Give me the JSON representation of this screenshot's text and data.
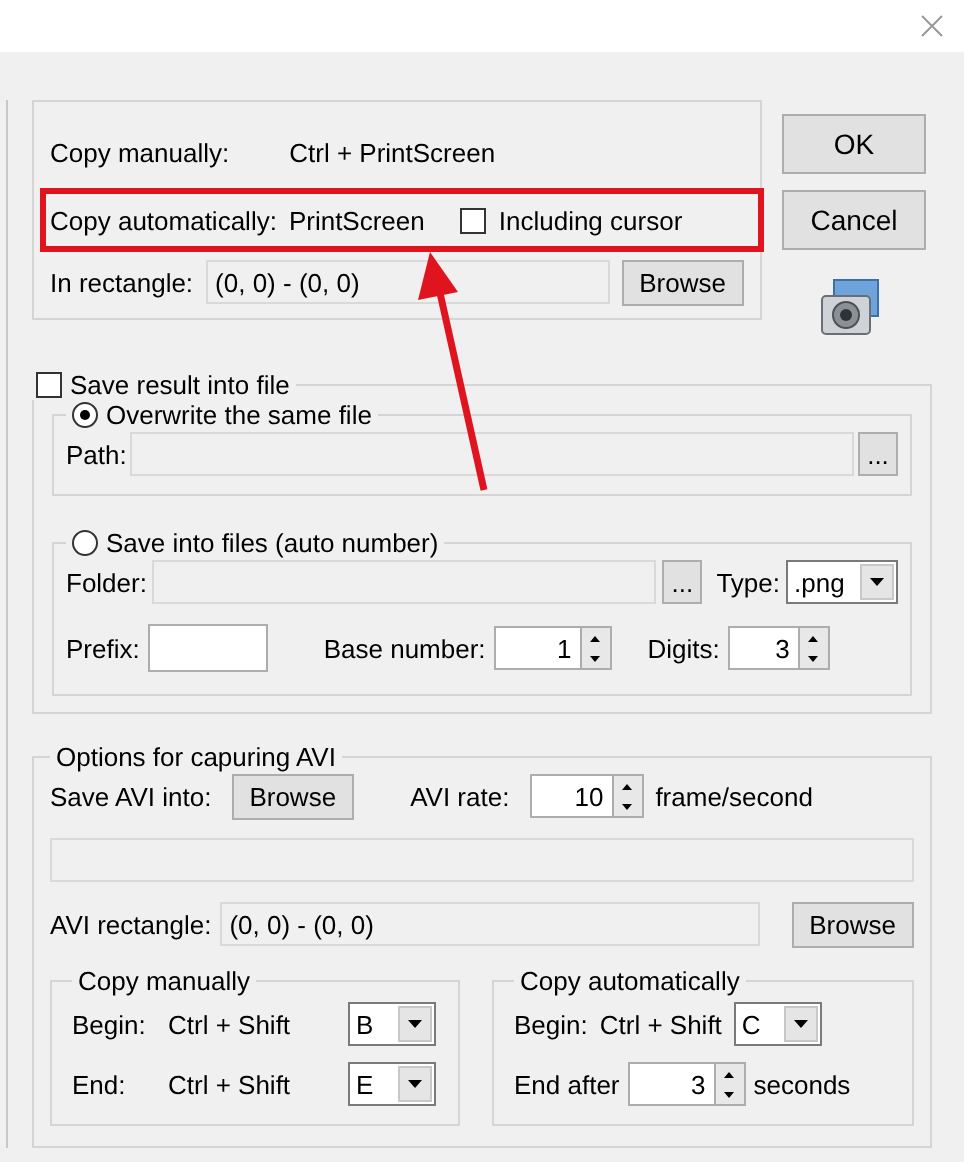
{
  "capture": {
    "copy_manually_label": "Copy manually:",
    "copy_manually_keys": "Ctrl + PrintScreen",
    "copy_auto_label": "Copy automatically:",
    "copy_auto_keys": "PrintScreen",
    "including_cursor": {
      "label": "Including cursor",
      "checked": false
    },
    "rect_label": "In rectangle:",
    "rect_value": "(0, 0) - (0, 0)",
    "browse": "Browse"
  },
  "buttons": [
    "OK",
    "Cancel"
  ],
  "save": {
    "label": "Save result into file",
    "checked": false,
    "overwrite": {
      "label": "Overwrite the same file",
      "selected": true,
      "path_label": "Path:",
      "path_button": "..."
    },
    "auto": {
      "label": "Save into files (auto number)",
      "selected": false,
      "folder_label": "Folder:",
      "folder_button": "...",
      "type_label": "Type:",
      "type_value": ".png",
      "prefix_label": "Prefix:",
      "base_label": "Base number:",
      "base_value": "1",
      "digits_label": "Digits:",
      "digits_value": "3"
    }
  },
  "avi": {
    "title": "Options for capuring AVI",
    "save_label": "Save AVI into:",
    "browse": "Browse",
    "rate_label": "AVI rate:",
    "rate_value": "10",
    "rate_unit": "frame/second",
    "rect_label": "AVI rectangle:",
    "rect_value": "(0, 0) - (0, 0)",
    "rect_browse": "Browse",
    "manual": {
      "title": "Copy manually",
      "begin_label": "Begin:",
      "begin_keys": "Ctrl + Shift",
      "begin_value": "B",
      "end_label": "End:",
      "end_keys": "Ctrl + Shift",
      "end_value": "E"
    },
    "auto": {
      "title": "Copy automatically",
      "begin_label": "Begin:",
      "begin_keys": "Ctrl + Shift",
      "begin_value": "C",
      "end_label": "End after",
      "end_value": "3",
      "end_unit": "seconds"
    }
  }
}
